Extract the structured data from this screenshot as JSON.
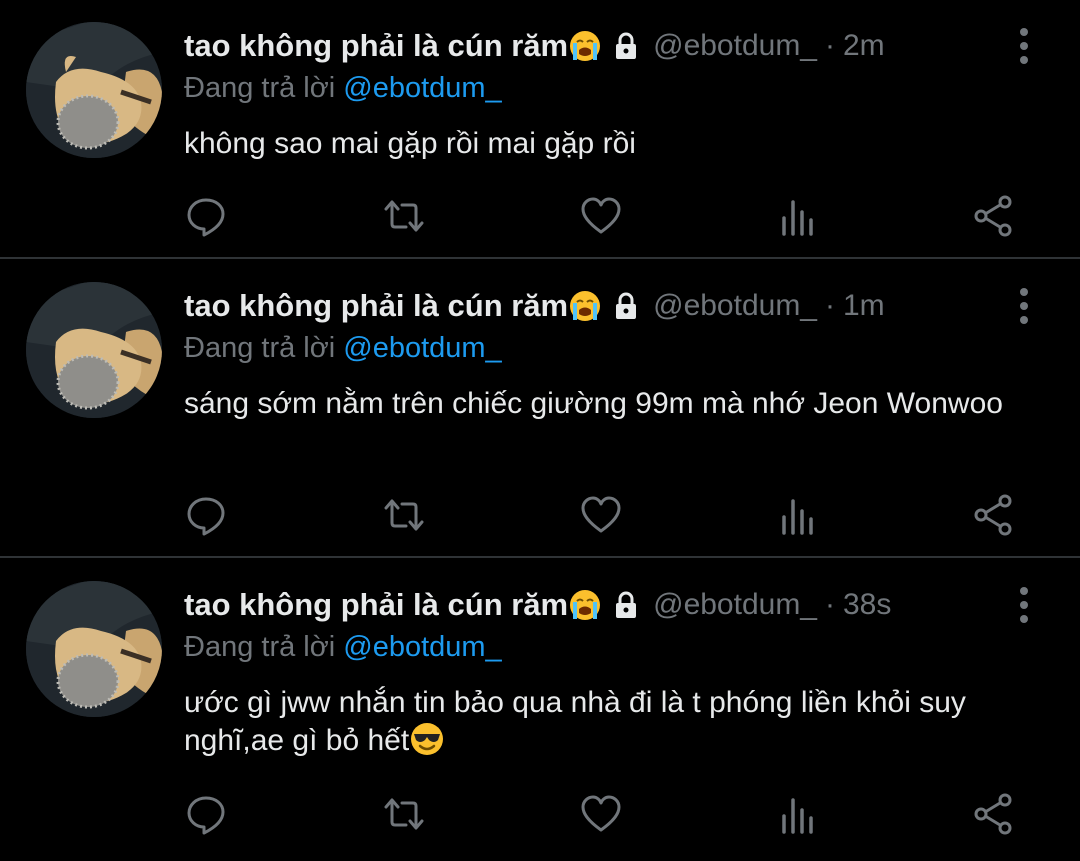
{
  "tweets": [
    {
      "name": "tao không phải là cún răm",
      "name_emoji": "loudly-crying-face",
      "lock_icon": "lock-icon",
      "handle": "@ebotdum_",
      "sep": "·",
      "time": "2m",
      "reply_prefix": "Đang trả lời",
      "reply_to": "@ebotdum_",
      "text": "không sao mai gặp rồi mai gặp rồi",
      "text_emoji": ""
    },
    {
      "name": "tao không phải là cún răm",
      "name_emoji": "loudly-crying-face",
      "lock_icon": "lock-icon",
      "handle": "@ebotdum_",
      "sep": "·",
      "time": "1m",
      "reply_prefix": "Đang trả lời",
      "reply_to": "@ebotdum_",
      "text": "sáng sớm nằm trên chiếc giường 99m mà nhớ Jeon Wonwoo",
      "text_emoji": ""
    },
    {
      "name": "tao không phải là cún răm",
      "name_emoji": "loudly-crying-face",
      "lock_icon": "lock-icon",
      "handle": "@ebotdum_",
      "sep": "·",
      "time": "38s",
      "reply_prefix": "Đang trả lời",
      "reply_to": "@ebotdum_",
      "text": "ước gì jww nhắn tin bảo qua nhà đi là t phóng liền khỏi suy nghĩ,ae gì bỏ hết",
      "text_emoji": "smiling-face-with-sunglasses"
    }
  ],
  "action_icons": [
    "reply-icon",
    "retweet-icon",
    "like-icon",
    "analytics-icon",
    "share-icon"
  ],
  "colors": {
    "background": "#000000",
    "text": "#e7e9ea",
    "muted": "#71767b",
    "mention": "#1d9bf0",
    "divider": "#2f3336"
  }
}
